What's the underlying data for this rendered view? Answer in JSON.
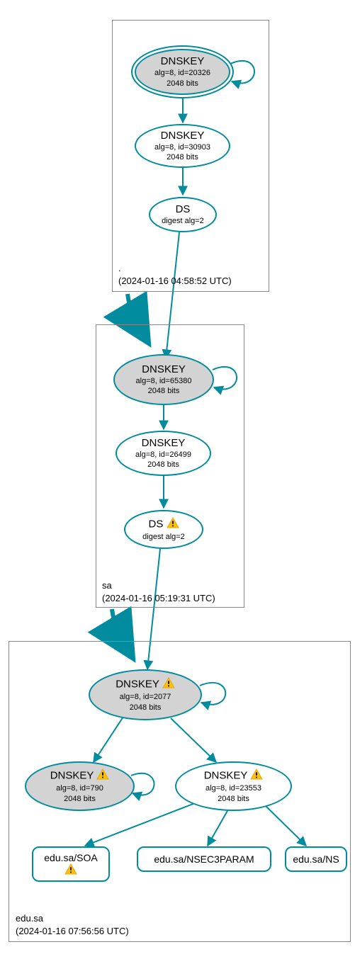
{
  "zones": {
    "root": {
      "name": ".",
      "timestamp": "(2024-01-16 04:58:52 UTC)",
      "dnskey_ksk": {
        "title": "DNSKEY",
        "sub1": "alg=8, id=20326",
        "sub2": "2048 bits"
      },
      "dnskey_zsk": {
        "title": "DNSKEY",
        "sub1": "alg=8, id=30903",
        "sub2": "2048 bits"
      },
      "ds": {
        "title": "DS",
        "sub1": "digest alg=2"
      }
    },
    "sa": {
      "name": "sa",
      "timestamp": "(2024-01-16 05:19:31 UTC)",
      "dnskey_ksk": {
        "title": "DNSKEY",
        "sub1": "alg=8, id=65380",
        "sub2": "2048 bits"
      },
      "dnskey_zsk": {
        "title": "DNSKEY",
        "sub1": "alg=8, id=26499",
        "sub2": "2048 bits"
      },
      "ds": {
        "title": "DS",
        "sub1": "digest alg=2",
        "warn": true
      }
    },
    "edusa": {
      "name": "edu.sa",
      "timestamp": "(2024-01-16 07:56:56 UTC)",
      "dnskey_ksk": {
        "title": "DNSKEY",
        "sub1": "alg=8, id=2077",
        "sub2": "2048 bits",
        "warn": true
      },
      "dnskey_790": {
        "title": "DNSKEY",
        "sub1": "alg=8, id=790",
        "sub2": "2048 bits",
        "warn": true
      },
      "dnskey_zsk": {
        "title": "DNSKEY",
        "sub1": "alg=8, id=23553",
        "sub2": "2048 bits",
        "warn": true
      },
      "soa": {
        "label": "edu.sa/SOA",
        "warn": true
      },
      "nsec3param": {
        "label": "edu.sa/NSEC3PARAM"
      },
      "ns": {
        "label": "edu.sa/NS"
      }
    }
  }
}
